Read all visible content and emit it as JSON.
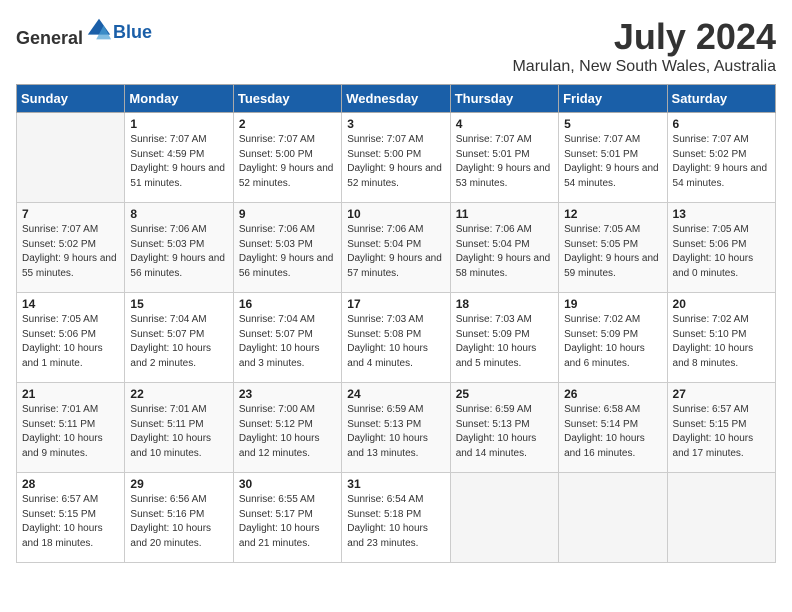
{
  "logo": {
    "general": "General",
    "blue": "Blue"
  },
  "title": {
    "month_year": "July 2024",
    "location": "Marulan, New South Wales, Australia"
  },
  "days_of_week": [
    "Sunday",
    "Monday",
    "Tuesday",
    "Wednesday",
    "Thursday",
    "Friday",
    "Saturday"
  ],
  "weeks": [
    [
      {
        "day": "",
        "sunrise": "",
        "sunset": "",
        "daylight": ""
      },
      {
        "day": "1",
        "sunrise": "Sunrise: 7:07 AM",
        "sunset": "Sunset: 4:59 PM",
        "daylight": "Daylight: 9 hours and 51 minutes."
      },
      {
        "day": "2",
        "sunrise": "Sunrise: 7:07 AM",
        "sunset": "Sunset: 5:00 PM",
        "daylight": "Daylight: 9 hours and 52 minutes."
      },
      {
        "day": "3",
        "sunrise": "Sunrise: 7:07 AM",
        "sunset": "Sunset: 5:00 PM",
        "daylight": "Daylight: 9 hours and 52 minutes."
      },
      {
        "day": "4",
        "sunrise": "Sunrise: 7:07 AM",
        "sunset": "Sunset: 5:01 PM",
        "daylight": "Daylight: 9 hours and 53 minutes."
      },
      {
        "day": "5",
        "sunrise": "Sunrise: 7:07 AM",
        "sunset": "Sunset: 5:01 PM",
        "daylight": "Daylight: 9 hours and 54 minutes."
      },
      {
        "day": "6",
        "sunrise": "Sunrise: 7:07 AM",
        "sunset": "Sunset: 5:02 PM",
        "daylight": "Daylight: 9 hours and 54 minutes."
      }
    ],
    [
      {
        "day": "7",
        "sunrise": "Sunrise: 7:07 AM",
        "sunset": "Sunset: 5:02 PM",
        "daylight": "Daylight: 9 hours and 55 minutes."
      },
      {
        "day": "8",
        "sunrise": "Sunrise: 7:06 AM",
        "sunset": "Sunset: 5:03 PM",
        "daylight": "Daylight: 9 hours and 56 minutes."
      },
      {
        "day": "9",
        "sunrise": "Sunrise: 7:06 AM",
        "sunset": "Sunset: 5:03 PM",
        "daylight": "Daylight: 9 hours and 56 minutes."
      },
      {
        "day": "10",
        "sunrise": "Sunrise: 7:06 AM",
        "sunset": "Sunset: 5:04 PM",
        "daylight": "Daylight: 9 hours and 57 minutes."
      },
      {
        "day": "11",
        "sunrise": "Sunrise: 7:06 AM",
        "sunset": "Sunset: 5:04 PM",
        "daylight": "Daylight: 9 hours and 58 minutes."
      },
      {
        "day": "12",
        "sunrise": "Sunrise: 7:05 AM",
        "sunset": "Sunset: 5:05 PM",
        "daylight": "Daylight: 9 hours and 59 minutes."
      },
      {
        "day": "13",
        "sunrise": "Sunrise: 7:05 AM",
        "sunset": "Sunset: 5:06 PM",
        "daylight": "Daylight: 10 hours and 0 minutes."
      }
    ],
    [
      {
        "day": "14",
        "sunrise": "Sunrise: 7:05 AM",
        "sunset": "Sunset: 5:06 PM",
        "daylight": "Daylight: 10 hours and 1 minute."
      },
      {
        "day": "15",
        "sunrise": "Sunrise: 7:04 AM",
        "sunset": "Sunset: 5:07 PM",
        "daylight": "Daylight: 10 hours and 2 minutes."
      },
      {
        "day": "16",
        "sunrise": "Sunrise: 7:04 AM",
        "sunset": "Sunset: 5:07 PM",
        "daylight": "Daylight: 10 hours and 3 minutes."
      },
      {
        "day": "17",
        "sunrise": "Sunrise: 7:03 AM",
        "sunset": "Sunset: 5:08 PM",
        "daylight": "Daylight: 10 hours and 4 minutes."
      },
      {
        "day": "18",
        "sunrise": "Sunrise: 7:03 AM",
        "sunset": "Sunset: 5:09 PM",
        "daylight": "Daylight: 10 hours and 5 minutes."
      },
      {
        "day": "19",
        "sunrise": "Sunrise: 7:02 AM",
        "sunset": "Sunset: 5:09 PM",
        "daylight": "Daylight: 10 hours and 6 minutes."
      },
      {
        "day": "20",
        "sunrise": "Sunrise: 7:02 AM",
        "sunset": "Sunset: 5:10 PM",
        "daylight": "Daylight: 10 hours and 8 minutes."
      }
    ],
    [
      {
        "day": "21",
        "sunrise": "Sunrise: 7:01 AM",
        "sunset": "Sunset: 5:11 PM",
        "daylight": "Daylight: 10 hours and 9 minutes."
      },
      {
        "day": "22",
        "sunrise": "Sunrise: 7:01 AM",
        "sunset": "Sunset: 5:11 PM",
        "daylight": "Daylight: 10 hours and 10 minutes."
      },
      {
        "day": "23",
        "sunrise": "Sunrise: 7:00 AM",
        "sunset": "Sunset: 5:12 PM",
        "daylight": "Daylight: 10 hours and 12 minutes."
      },
      {
        "day": "24",
        "sunrise": "Sunrise: 6:59 AM",
        "sunset": "Sunset: 5:13 PM",
        "daylight": "Daylight: 10 hours and 13 minutes."
      },
      {
        "day": "25",
        "sunrise": "Sunrise: 6:59 AM",
        "sunset": "Sunset: 5:13 PM",
        "daylight": "Daylight: 10 hours and 14 minutes."
      },
      {
        "day": "26",
        "sunrise": "Sunrise: 6:58 AM",
        "sunset": "Sunset: 5:14 PM",
        "daylight": "Daylight: 10 hours and 16 minutes."
      },
      {
        "day": "27",
        "sunrise": "Sunrise: 6:57 AM",
        "sunset": "Sunset: 5:15 PM",
        "daylight": "Daylight: 10 hours and 17 minutes."
      }
    ],
    [
      {
        "day": "28",
        "sunrise": "Sunrise: 6:57 AM",
        "sunset": "Sunset: 5:15 PM",
        "daylight": "Daylight: 10 hours and 18 minutes."
      },
      {
        "day": "29",
        "sunrise": "Sunrise: 6:56 AM",
        "sunset": "Sunset: 5:16 PM",
        "daylight": "Daylight: 10 hours and 20 minutes."
      },
      {
        "day": "30",
        "sunrise": "Sunrise: 6:55 AM",
        "sunset": "Sunset: 5:17 PM",
        "daylight": "Daylight: 10 hours and 21 minutes."
      },
      {
        "day": "31",
        "sunrise": "Sunrise: 6:54 AM",
        "sunset": "Sunset: 5:18 PM",
        "daylight": "Daylight: 10 hours and 23 minutes."
      },
      {
        "day": "",
        "sunrise": "",
        "sunset": "",
        "daylight": ""
      },
      {
        "day": "",
        "sunrise": "",
        "sunset": "",
        "daylight": ""
      },
      {
        "day": "",
        "sunrise": "",
        "sunset": "",
        "daylight": ""
      }
    ]
  ]
}
